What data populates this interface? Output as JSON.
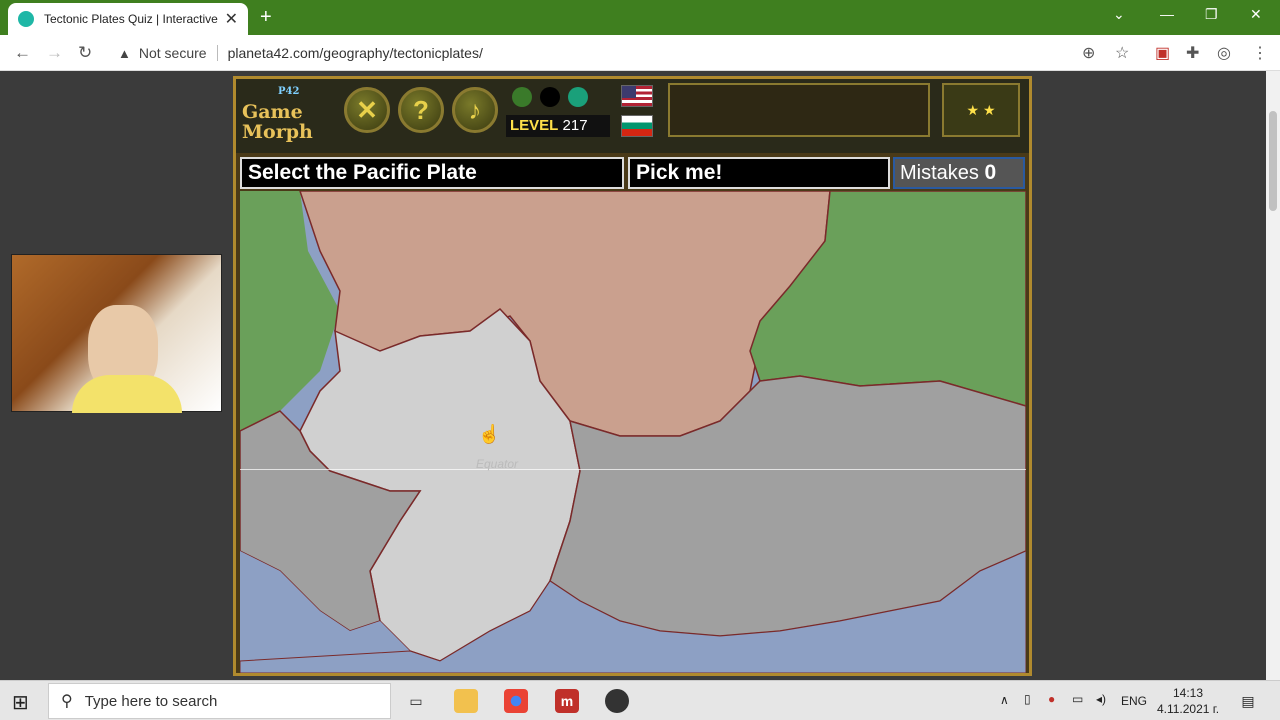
{
  "browser": {
    "tab_title": "Tectonic Plates Quiz | Interactive",
    "security_label": "Not secure",
    "url": "planeta42.com/geography/tectonicplates/"
  },
  "game": {
    "logo_tag": "P42",
    "logo_line1": "Game",
    "logo_line2": "Morph",
    "level_label": "LEVEL",
    "level_value": "217",
    "question": "Select the Pacific Plate",
    "pick_label": "Pick me!",
    "mistakes_label": "Mistakes",
    "mistakes_value": "0",
    "equator_label": "Equator"
  },
  "taskbar": {
    "search_placeholder": "Type here to search",
    "language": "ENG",
    "time": "14:13",
    "date": "4.11.2021 г."
  },
  "colors": {
    "tabbar": "#3f7f1f",
    "pacific_plate": "#d0d0d0",
    "other_plates": "#a0a0a0",
    "north_american_land": "#caa08e",
    "eurasian_land": "#6aa05a",
    "ocean": "#8da0c4"
  }
}
